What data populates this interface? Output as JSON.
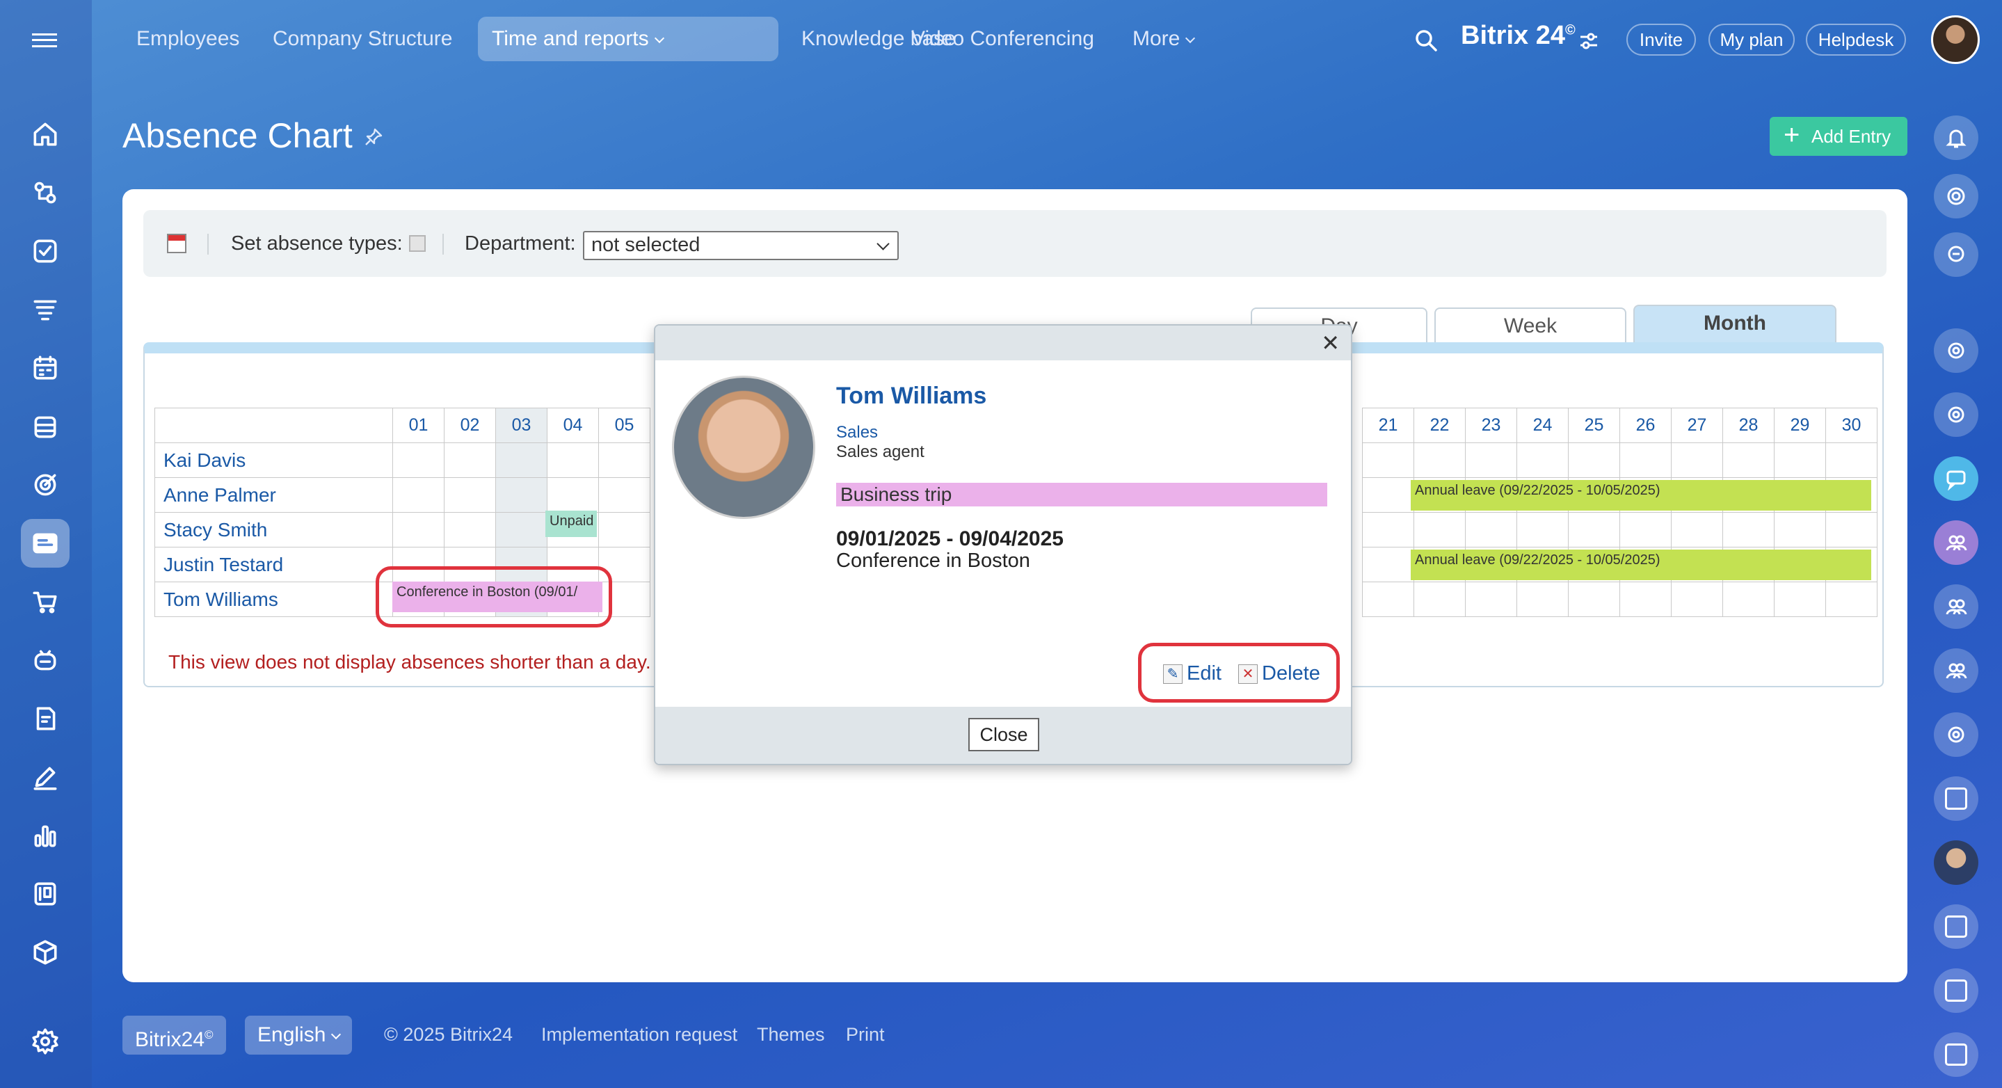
{
  "nav": {
    "items": [
      "Employees",
      "Company Structure",
      "Time and reports",
      "Knowledge base",
      "Video Conferencing",
      "More"
    ],
    "brand": "Bitrix 24",
    "brand_mark": "©",
    "invite": "Invite",
    "my_plan": "My plan",
    "helpdesk": "Helpdesk"
  },
  "page": {
    "title": "Absence Chart",
    "add_entry": "Add Entry"
  },
  "toolbar": {
    "absence_types_label": "Set absence types:",
    "department_label": "Department:",
    "department_value": "not selected"
  },
  "tabs": [
    "Day",
    "Week",
    "Month"
  ],
  "chart": {
    "days_left": [
      "01",
      "02",
      "03",
      "04",
      "05"
    ],
    "days_right": [
      "21",
      "22",
      "23",
      "24",
      "25",
      "26",
      "27",
      "28",
      "29",
      "30"
    ],
    "employees": [
      "Kai Davis",
      "Anne Palmer",
      "Stacy Smith",
      "Justin Testard",
      "Tom Williams"
    ],
    "bars": {
      "conference": "Conference in Boston (09/01/",
      "unpaid": "Unpaid",
      "annual1": "Annual leave (09/22/2025 - 10/05/2025)",
      "annual2": "Annual leave (09/22/2025 - 10/05/2025)"
    },
    "note": "This view does not display absences shorter than a day."
  },
  "dialog": {
    "name": "Tom Williams",
    "department": "Sales",
    "position": "Sales agent",
    "type": "Business trip",
    "dates": "09/01/2025 - 09/04/2025",
    "description": "Conference in Boston",
    "edit": "Edit",
    "delete": "Delete",
    "close": "Close"
  },
  "footer": {
    "brand": "Bitrix24",
    "brand_mark": "©",
    "language": "English",
    "copyright": "© 2025 Bitrix24",
    "links": [
      "Implementation request",
      "Themes",
      "Print"
    ]
  },
  "colors": {
    "business_trip": "#ebb1ea",
    "annual_leave": "#c3e152",
    "unpaid": "#a9e3d0",
    "add_button": "#3bc8a0",
    "highlight": "#e0333d"
  }
}
